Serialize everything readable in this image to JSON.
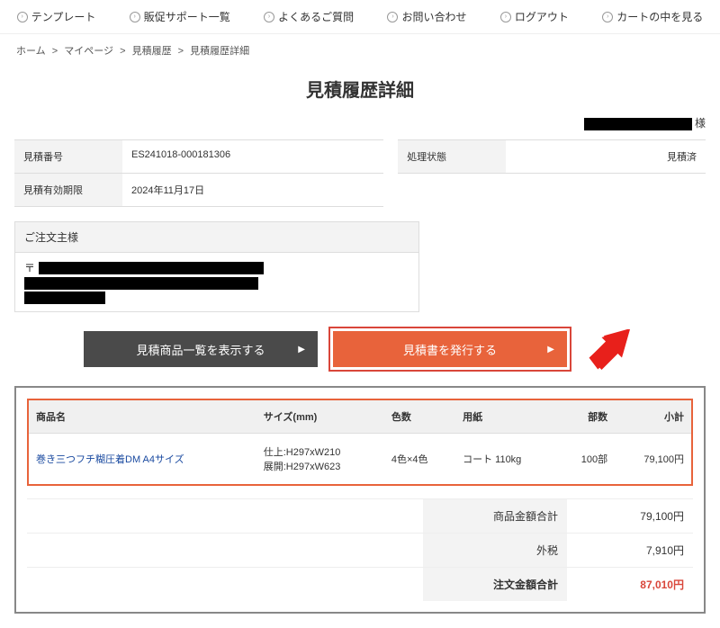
{
  "nav": {
    "template": "テンプレート",
    "support": "販促サポート一覧",
    "faq": "よくあるご質問",
    "contact": "お問い合わせ",
    "logout": "ログアウト",
    "cart": "カートの中を見る"
  },
  "breadcrumb": {
    "home": "ホーム",
    "mypage": "マイページ",
    "history": "見積履歴",
    "detail": "見積履歴詳細",
    "sep": ">"
  },
  "page_title": "見積履歴詳細",
  "customer_suffix": "様",
  "info": {
    "estimate_no_label": "見積番号",
    "estimate_no": "ES241018-000181306",
    "valid_until_label": "見積有効期限",
    "valid_until": "2024年11月17日",
    "status_label": "処理状態",
    "status": "見積済"
  },
  "orderer": {
    "heading": "ご注文主様",
    "postal_mark": "〒"
  },
  "buttons": {
    "show_list": "見積商品一覧を表示する",
    "issue": "見積書を発行する"
  },
  "table": {
    "headers": {
      "name": "商品名",
      "size": "サイズ(mm)",
      "colors": "色数",
      "paper": "用紙",
      "qty": "部数",
      "subtotal": "小計"
    },
    "row": {
      "name": "巻き三つフチ糊圧着DM A4サイズ",
      "size_line1": "仕上:H297xW210",
      "size_line2": "展開:H297xW623",
      "colors": "4色×4色",
      "paper": "コート 110kg",
      "qty": "100部",
      "subtotal": "79,100円"
    }
  },
  "totals": {
    "goods_label": "商品金額合計",
    "goods_value": "79,100円",
    "tax_label": "外税",
    "tax_value": "7,910円",
    "order_label": "注文金額合計",
    "order_value": "87,010円"
  }
}
